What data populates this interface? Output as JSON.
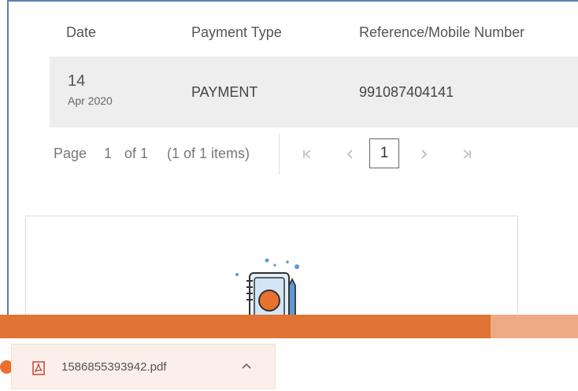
{
  "table": {
    "headers": {
      "date": "Date",
      "payment_type": "Payment Type",
      "reference": "Reference/Mobile Number"
    },
    "rows": [
      {
        "day": "14",
        "month_year": "Apr 2020",
        "payment_type": "PAYMENT",
        "reference": "991087404141"
      }
    ]
  },
  "pager": {
    "page_label": "Page",
    "page_number": "1",
    "of_label": "of 1",
    "items_label": "(1 of 1 items)",
    "first_icon": "first-page-icon",
    "prev_icon": "previous-page-icon",
    "current": "1",
    "next_icon": "next-page-icon",
    "last_icon": "last-page-icon"
  },
  "download": {
    "file_name": "1586855393942.pdf",
    "icon": "pdf-icon",
    "chevron": "chevron-up-icon"
  },
  "colors": {
    "accent": "#e07434",
    "accent_light": "#eeaa86",
    "border": "#5b7fb5",
    "row_bg": "#eeeeee"
  }
}
